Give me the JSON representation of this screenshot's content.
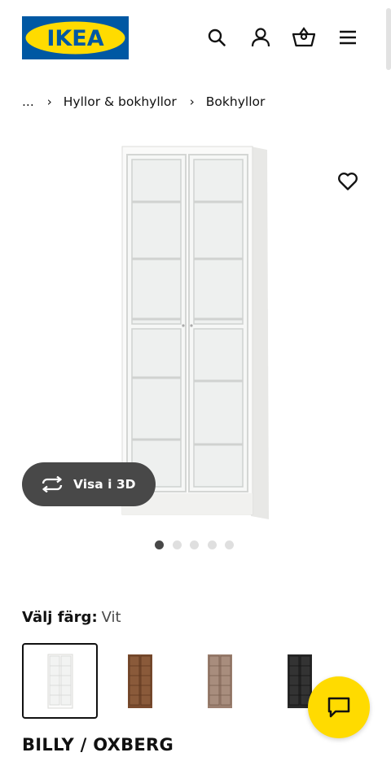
{
  "header": {
    "logo_text": "IKEA",
    "icons": [
      "search-icon",
      "account-icon",
      "cart-icon",
      "menu-icon"
    ]
  },
  "breadcrumb": {
    "items": [
      "...",
      "Hyllor & bokhyllor",
      "Bokhyllor"
    ]
  },
  "gallery": {
    "view_3d_label": "Visa i 3D",
    "dot_count": 5,
    "active_index": 0
  },
  "color_picker": {
    "label": "Välj färg:",
    "value": "Vit",
    "options": [
      {
        "color": "#ffffff",
        "selected": true
      },
      {
        "color": "#7a4b2e",
        "selected": false
      },
      {
        "color": "#9c8070",
        "selected": false
      },
      {
        "color": "#2a2a2a",
        "selected": false
      }
    ]
  },
  "product": {
    "title": "BILLY / OXBERG"
  },
  "colors": {
    "brand_blue": "#0058a3",
    "brand_yellow": "#ffdb00",
    "dark_button": "#484848"
  }
}
